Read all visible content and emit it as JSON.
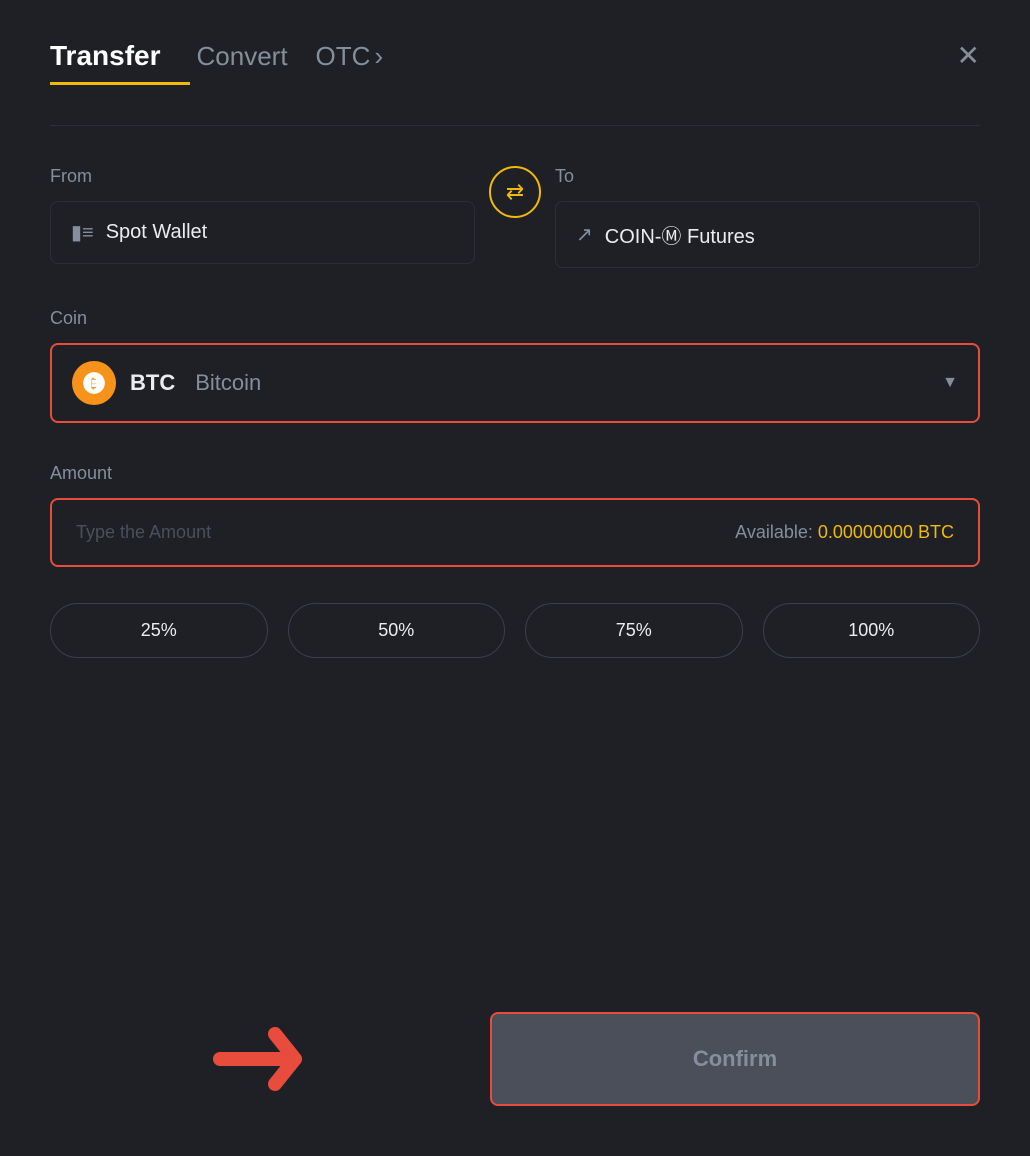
{
  "header": {
    "tab_transfer": "Transfer",
    "tab_convert": "Convert",
    "tab_otc": "OTC",
    "otc_arrow": "›",
    "close_icon": "✕"
  },
  "from_section": {
    "label": "From",
    "wallet_name": "Spot Wallet",
    "wallet_icon": "🪪"
  },
  "swap": {
    "icon": "⇄"
  },
  "to_section": {
    "label": "To",
    "wallet_name": "COIN-Ⓜ Futures",
    "wallet_icon": "↑"
  },
  "coin_section": {
    "label": "Coin",
    "coin_symbol": "BTC",
    "coin_name": "Bitcoin",
    "chevron": "▼"
  },
  "amount_section": {
    "label": "Amount",
    "placeholder": "Type the Amount",
    "available_label": "Available:",
    "available_amount": "0.00000000 BTC"
  },
  "pct_buttons": [
    {
      "label": "25%"
    },
    {
      "label": "50%"
    },
    {
      "label": "75%"
    },
    {
      "label": "100%"
    }
  ],
  "confirm_button": {
    "label": "Confirm"
  },
  "colors": {
    "accent": "#f0b90b",
    "error_border": "#e74c3c",
    "bg": "#1e2026",
    "text_primary": "#eaecef",
    "text_secondary": "#848e9c"
  }
}
